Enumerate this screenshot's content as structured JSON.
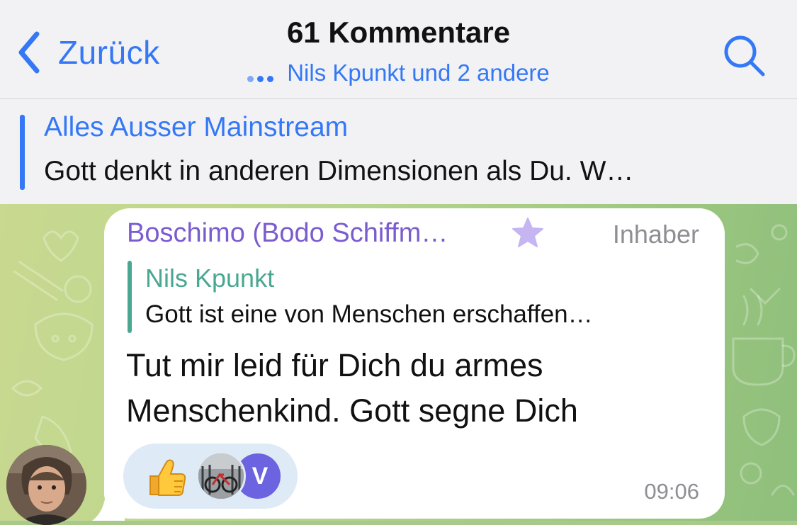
{
  "header": {
    "back_label": "Zurück",
    "title": "61 Kommentare",
    "subtitle": "Nils Kpunkt und 2 andere"
  },
  "banner": {
    "title": "Alles Ausser Mainstream",
    "text": "Gott denkt in anderen Dimensionen als Du. W…"
  },
  "message": {
    "sender": "Boschimo (Bodo Schiffm…",
    "role": "Inhaber",
    "reply_to": {
      "name": "Nils Kpunkt",
      "text": "Gott ist eine von Menschen erschaffen…"
    },
    "text": "Tut mir leid für Dich du armes Menschenkind. Gott segne Dich",
    "time": "09:06",
    "reactions": {
      "emoji": "thumbs-up",
      "avatar_letter": "V"
    }
  },
  "colors": {
    "accent": "#3478f6",
    "sender": "#7b5ccf",
    "quote": "#4aa792",
    "meta": "#8e8e93"
  }
}
